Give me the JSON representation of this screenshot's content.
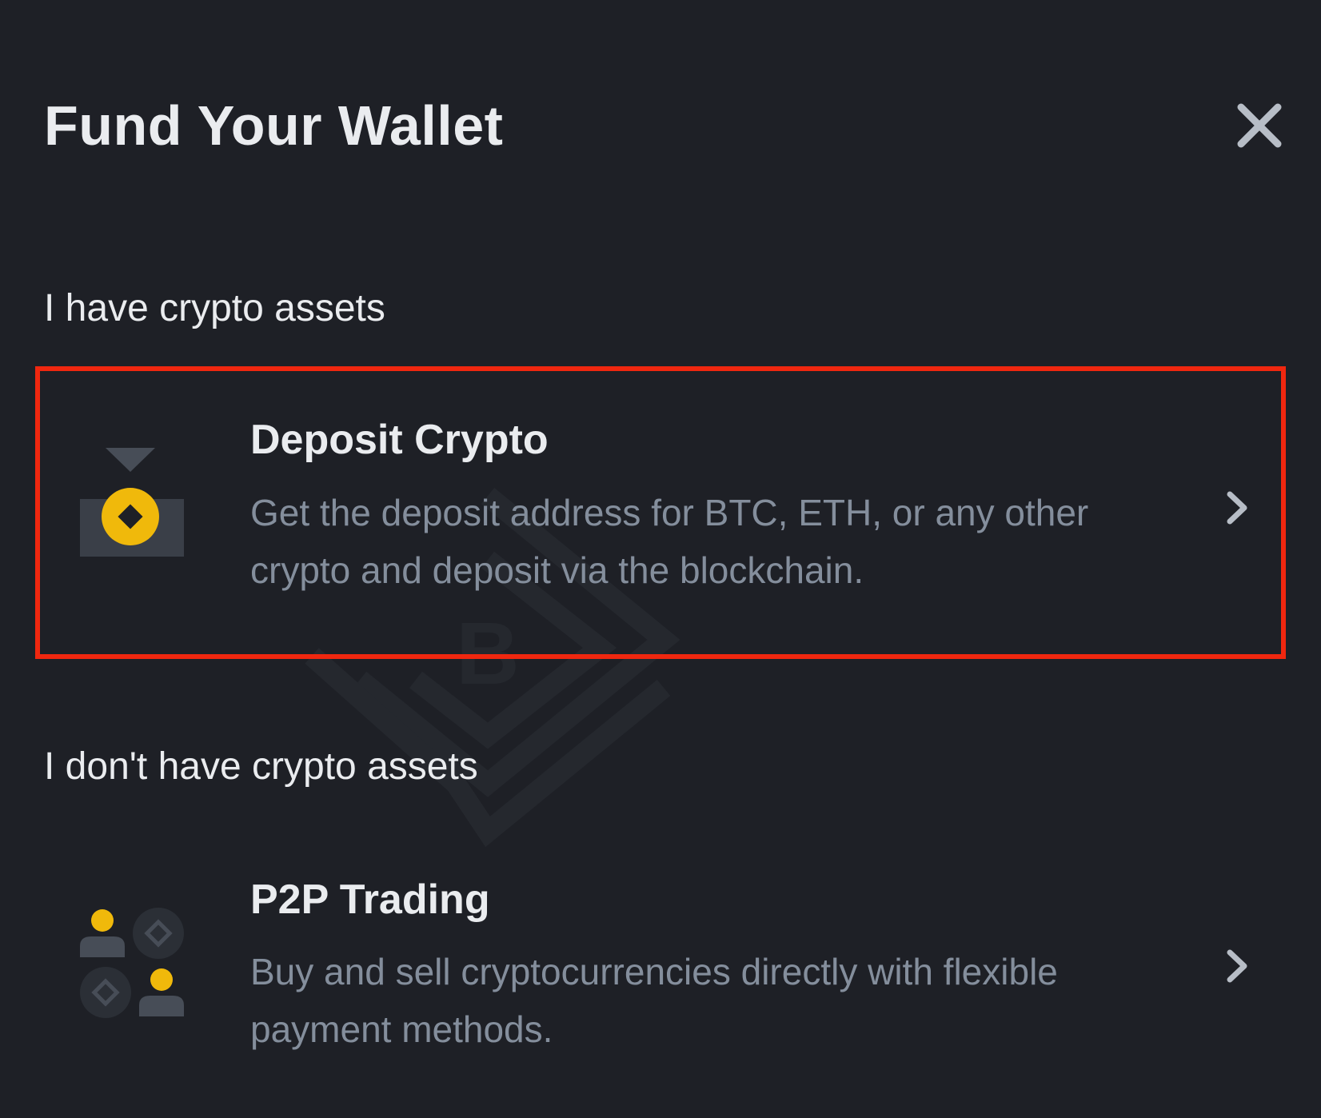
{
  "dialog": {
    "title": "Fund Your Wallet",
    "close_icon": "close-icon"
  },
  "sections": {
    "have_assets": {
      "label": "I have crypto assets",
      "option": {
        "title": "Deposit Crypto",
        "description": "Get the deposit address for BTC, ETH, or any other crypto and deposit via the blockchain.",
        "icon": "deposit-icon",
        "chevron_icon": "chevron-right-icon"
      }
    },
    "no_assets": {
      "label": "I don't have crypto assets",
      "option": {
        "title": "P2P Trading",
        "description": "Buy and sell cryptocurrencies directly with flexible payment methods.",
        "icon": "p2p-icon",
        "chevron_icon": "chevron-right-icon"
      }
    }
  },
  "colors": {
    "background": "#1e2026",
    "accent": "#f0b90b",
    "highlight": "#f0270f",
    "secondary_text": "#848e9c"
  }
}
